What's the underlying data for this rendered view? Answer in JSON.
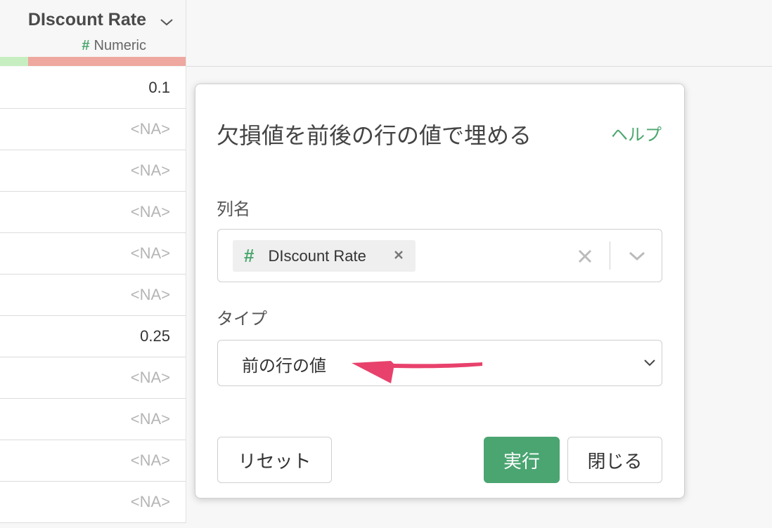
{
  "column": {
    "name": "DIscount Rate",
    "type_symbol": "#",
    "type_label": "Numeric",
    "type_color": "#4ca66e",
    "quality_valid_color": "#c7eec1",
    "quality_missing_color": "#eea89f",
    "dropdown_icon": "chevron-down-icon"
  },
  "cells": [
    "0.1",
    "<NA>",
    "<NA>",
    "<NA>",
    "<NA>",
    "<NA>",
    "0.25",
    "<NA>",
    "<NA>",
    "<NA>",
    "<NA>"
  ],
  "dialog": {
    "title": "欠損値を前後の行の値で埋める",
    "help_label": "ヘルプ",
    "column_field": {
      "label": "列名",
      "selected_symbol": "#",
      "selected_value": "DIscount Rate",
      "remove_icon": "close-icon",
      "clear_icon": "clear-icon",
      "open_icon": "chevron-down-icon"
    },
    "type_field": {
      "label": "タイプ",
      "selected_value": "前の行の値"
    },
    "buttons": {
      "reset": "リセット",
      "run": "実行",
      "close": "閉じる"
    },
    "accent_color": "#4aa571",
    "annotation_arrow_color": "#e8416c"
  }
}
